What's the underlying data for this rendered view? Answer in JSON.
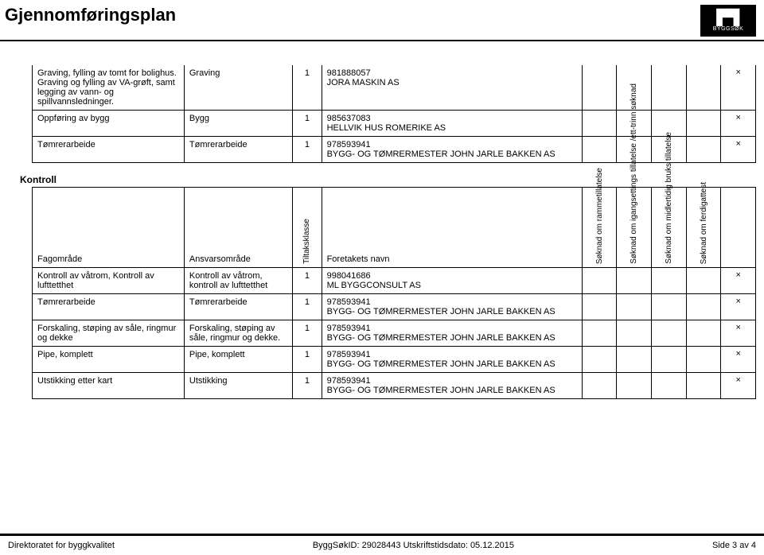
{
  "header": {
    "title": "Gjennomføringsplan",
    "logo_text": "BYGGSØK"
  },
  "exec_cols": {
    "c1w": "21%",
    "c2w": "15%",
    "c3w": "4%",
    "c4w": "38%",
    "c5w": "4.4%",
    "c6w": "4.4%",
    "c7w": "4.4%",
    "c8w": "4.4%",
    "c9w": "4.4%"
  },
  "exec_rows": [
    {
      "a": "Graving, fylling av tomt for bolighus. Graving og fylling av VA-grøft, samt legging av vann- og spillvannsledninger.",
      "b": "Graving",
      "c": "1",
      "d": "981888057\n JORA MASKIN AS",
      "marks": [
        "",
        "",
        "",
        "",
        "×"
      ]
    },
    {
      "a": "Oppføring av bygg",
      "b": "Bygg",
      "c": "1",
      "d": "985637083\n HELLVIK HUS ROMERIKE AS",
      "marks": [
        "",
        "",
        "",
        "",
        "×"
      ]
    },
    {
      "a": "Tømrerarbeide",
      "b": "Tømrerarbeide",
      "c": "1",
      "d": "978593941\n BYGG- OG TØMRERMESTER JOHN JARLE BAKKEN AS",
      "marks": [
        "",
        "",
        "",
        "",
        "×"
      ]
    }
  ],
  "control": {
    "section": "Kontroll",
    "headers": {
      "fag": "Fagområde",
      "ansvar": "Ansvarsområde",
      "klasse": "Tiltaksklasse",
      "navn": "Foretakets navn",
      "h1": "Søknad om\nrammetillatelse",
      "h2": "Søknad om\nigangsettings\ntillatelse\n/ett-trinn søknad",
      "h3": "Søknad om\nmidlertidig bruks\ntillatelse",
      "h4": "Søknad om\nferdigattest"
    },
    "rows": [
      {
        "a": "Kontroll av våtrom, Kontroll av lufttetthet",
        "b": "Kontroll av våtrom, kontroll av lufttetthet",
        "c": "1",
        "d": "998041686\n ML BYGGCONSULT AS",
        "marks": [
          "",
          "",
          "",
          "",
          "×"
        ]
      },
      {
        "a": "Tømrerarbeide",
        "b": "Tømrerarbeide",
        "c": "1",
        "d": "978593941\n BYGG- OG TØMRERMESTER JOHN JARLE BAKKEN AS",
        "marks": [
          "",
          "",
          "",
          "",
          "×"
        ]
      },
      {
        "a": "Forskaling, støping av såle, ringmur og dekke",
        "b": "Forskaling, støping av såle, ringmur og dekke.",
        "c": "1",
        "d": "978593941\n BYGG- OG TØMRERMESTER JOHN JARLE BAKKEN AS",
        "marks": [
          "",
          "",
          "",
          "",
          "×"
        ]
      },
      {
        "a": "Pipe, komplett",
        "b": "Pipe, komplett",
        "c": "1",
        "d": "978593941\n BYGG- OG TØMRERMESTER JOHN JARLE BAKKEN AS",
        "marks": [
          "",
          "",
          "",
          "",
          "×"
        ]
      },
      {
        "a": "Utstikking etter kart",
        "b": "Utstikking",
        "c": "1",
        "d": "978593941\n BYGG- OG TØMRERMESTER JOHN JARLE BAKKEN AS",
        "marks": [
          "",
          "",
          "",
          "",
          "×"
        ]
      }
    ]
  },
  "footer": {
    "left": "Direktoratet for byggkvalitet",
    "center": "ByggSøkID: 29028443 Utskriftstidsdato: 05.12.2015",
    "right": "Side 3 av 4"
  }
}
